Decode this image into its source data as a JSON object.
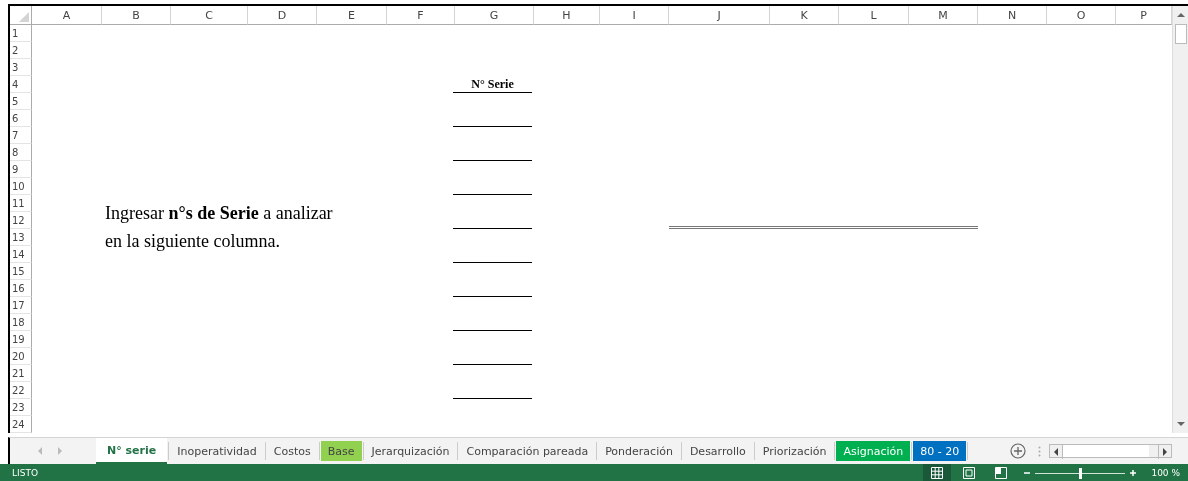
{
  "sheet": {
    "columns": [
      "A",
      "B",
      "C",
      "D",
      "E",
      "F",
      "G",
      "H",
      "I",
      "J",
      "K",
      "L",
      "M",
      "N",
      "O",
      "P"
    ],
    "rows": [
      "1",
      "2",
      "3",
      "4",
      "5",
      "6",
      "7",
      "8",
      "9",
      "10",
      "11",
      "12",
      "13",
      "14",
      "15",
      "16",
      "17",
      "18",
      "19",
      "20",
      "21",
      "22",
      "23",
      "24"
    ],
    "series_heading": "N° Serie",
    "instruction_lines": [
      "Ingresar **n°s de Serie** a analizar",
      "en la siguiente columna."
    ]
  },
  "tabs": [
    {
      "label": "N° serie",
      "selected": true
    },
    {
      "label": "Inoperatividad",
      "selected": false
    },
    {
      "label": "Costos",
      "selected": false
    },
    {
      "label": "Base",
      "selected": false,
      "color": "#92d050"
    },
    {
      "label": "Jerarquización",
      "selected": false
    },
    {
      "label": "Comparación pareada",
      "selected": false
    },
    {
      "label": "Ponderación",
      "selected": false
    },
    {
      "label": "Desarrollo",
      "selected": false
    },
    {
      "label": "Priorización",
      "selected": false
    },
    {
      "label": "Asignación",
      "selected": false,
      "color": "#00b050"
    },
    {
      "label": "80 - 20",
      "selected": false,
      "color": "#0070c0"
    }
  ],
  "status_bar": {
    "status": "LISTO",
    "zoom": {
      "level": 0.5,
      "reading": "100 %"
    }
  }
}
